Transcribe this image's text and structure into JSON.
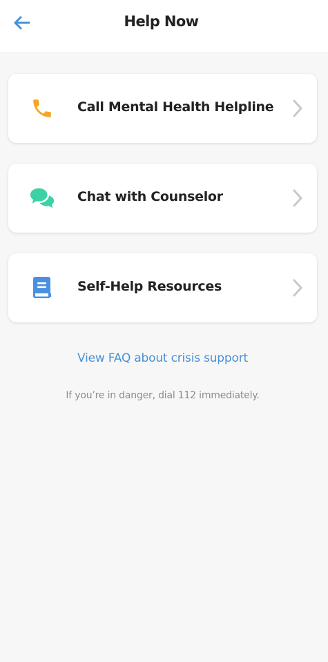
{
  "header": {
    "title": "Help Now",
    "back_icon": "arrow-left-icon"
  },
  "colors": {
    "accent_blue": "#4a90d9",
    "phone_orange": "#f5a623",
    "chat_teal": "#3cd2a5",
    "book_blue": "#4a90e2",
    "chevron_gray": "#c8c8c8"
  },
  "options": [
    {
      "label": "Call Mental Health Helpline",
      "icon": "phone-icon"
    },
    {
      "label": "Chat with Counselor",
      "icon": "chat-bubbles-icon"
    },
    {
      "label": "Self-Help Resources",
      "icon": "book-icon"
    }
  ],
  "faq_link": "View FAQ about crisis support",
  "danger_note": "If you’re in danger, dial 112 immediately."
}
